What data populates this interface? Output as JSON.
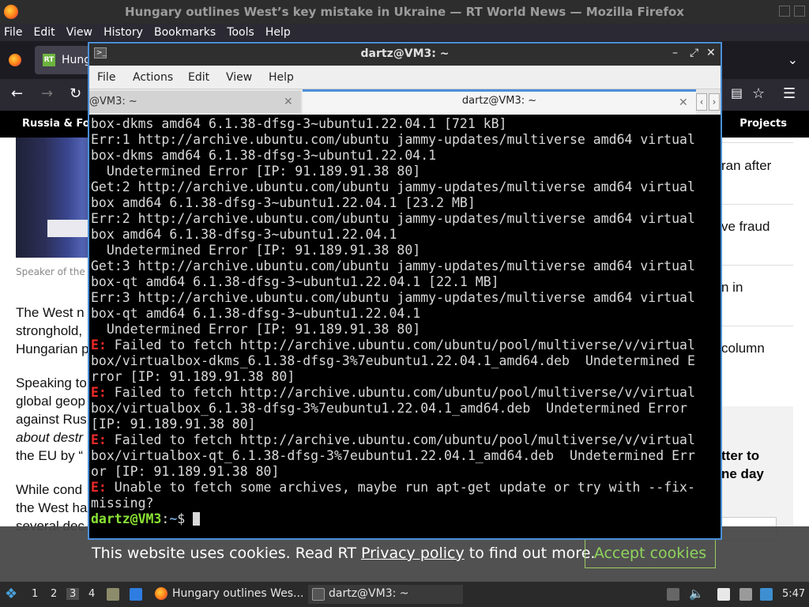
{
  "firefox": {
    "window_title": "Hungary outlines West’s key mistake in Ukraine — RT World News — Mozilla Firefox",
    "menu": [
      "File",
      "Edit",
      "View",
      "History",
      "Bookmarks",
      "Tools",
      "Help"
    ],
    "tab_label": "Hung",
    "tab_favicon": "RT"
  },
  "rt_nav": {
    "left_label": "Russia & Fori",
    "right_label": "Projects"
  },
  "article": {
    "caption": "Speaker of the",
    "body": [
      "The West n",
      "stronghold,",
      "Hungarian p",
      "Speaking to",
      "global geop",
      "against Rus",
      "about destr",
      "the EU by “",
      "While cond",
      "the West ha",
      "several dec"
    ],
    "sidebar": [
      "ran after",
      "ve fraud",
      "n in",
      "column"
    ],
    "promo": [
      "tter to",
      "ne day"
    ]
  },
  "cookie": {
    "text_before": "This website uses cookies. Read RT",
    "link": "Privacy policy",
    "text_after": "to find out more.",
    "accept": "Accept cookies"
  },
  "terminal": {
    "window_title": "dartz@VM3: ~",
    "menu": [
      "File",
      "Actions",
      "Edit",
      "View",
      "Help"
    ],
    "tabs": [
      "@VM3: ~",
      "dartz@VM3: ~"
    ],
    "lines": [
      {
        "prefix": "",
        "text": "box-dkms amd64 6.1.38-dfsg-3~ubuntu1.22.04.1 [721 kB]"
      },
      {
        "prefix": "",
        "text": "Err:1 http://archive.ubuntu.com/ubuntu jammy-updates/multiverse amd64 virtual"
      },
      {
        "prefix": "",
        "text": "box-dkms amd64 6.1.38-dfsg-3~ubuntu1.22.04.1"
      },
      {
        "prefix": "",
        "text": "  Undetermined Error [IP: 91.189.91.38 80]"
      },
      {
        "prefix": "",
        "text": "Get:2 http://archive.ubuntu.com/ubuntu jammy-updates/multiverse amd64 virtual"
      },
      {
        "prefix": "",
        "text": "box amd64 6.1.38-dfsg-3~ubuntu1.22.04.1 [23.2 MB]"
      },
      {
        "prefix": "",
        "text": "Err:2 http://archive.ubuntu.com/ubuntu jammy-updates/multiverse amd64 virtual"
      },
      {
        "prefix": "",
        "text": "box amd64 6.1.38-dfsg-3~ubuntu1.22.04.1"
      },
      {
        "prefix": "",
        "text": "  Undetermined Error [IP: 91.189.91.38 80]"
      },
      {
        "prefix": "",
        "text": "Get:3 http://archive.ubuntu.com/ubuntu jammy-updates/multiverse amd64 virtual"
      },
      {
        "prefix": "",
        "text": "box-qt amd64 6.1.38-dfsg-3~ubuntu1.22.04.1 [22.1 MB]"
      },
      {
        "prefix": "",
        "text": "Err:3 http://archive.ubuntu.com/ubuntu jammy-updates/multiverse amd64 virtual"
      },
      {
        "prefix": "",
        "text": "box-qt amd64 6.1.38-dfsg-3~ubuntu1.22.04.1"
      },
      {
        "prefix": "",
        "text": "  Undetermined Error [IP: 91.189.91.38 80]"
      },
      {
        "prefix": "E:",
        "text": " Failed to fetch http://archive.ubuntu.com/ubuntu/pool/multiverse/v/virtual"
      },
      {
        "prefix": "",
        "text": "box/virtualbox-dkms_6.1.38-dfsg-3%7eubuntu1.22.04.1_amd64.deb  Undetermined E"
      },
      {
        "prefix": "",
        "text": "rror [IP: 91.189.91.38 80]"
      },
      {
        "prefix": "E:",
        "text": " Failed to fetch http://archive.ubuntu.com/ubuntu/pool/multiverse/v/virtual"
      },
      {
        "prefix": "",
        "text": "box/virtualbox_6.1.38-dfsg-3%7eubuntu1.22.04.1_amd64.deb  Undetermined Error"
      },
      {
        "prefix": "",
        "text": "[IP: 91.189.91.38 80]"
      },
      {
        "prefix": "E:",
        "text": " Failed to fetch http://archive.ubuntu.com/ubuntu/pool/multiverse/v/virtual"
      },
      {
        "prefix": "",
        "text": "box/virtualbox-qt_6.1.38-dfsg-3%7eubuntu1.22.04.1_amd64.deb  Undetermined Err"
      },
      {
        "prefix": "",
        "text": "or [IP: 91.189.91.38 80]"
      },
      {
        "prefix": "E:",
        "text": " Unable to fetch some archives, maybe run apt-get update or try with --fix-"
      },
      {
        "prefix": "",
        "text": "missing?"
      }
    ],
    "prompt": {
      "user": "dartz@VM3",
      "sep": ":",
      "path": "~",
      "symbol": "$ "
    }
  },
  "taskbar": {
    "workspaces": [
      "1",
      "2",
      "3",
      "4"
    ],
    "active_workspace": "3",
    "tasks": [
      "Hungary outlines Wes...",
      "dartz@VM3: ~"
    ],
    "clock": "5:47"
  },
  "colors": {
    "accent": "#4a90d9",
    "term_error": "#ef2929",
    "term_user": "#8ae234",
    "term_path": "#729fcf",
    "cookie_accept": "#8fd45c"
  }
}
